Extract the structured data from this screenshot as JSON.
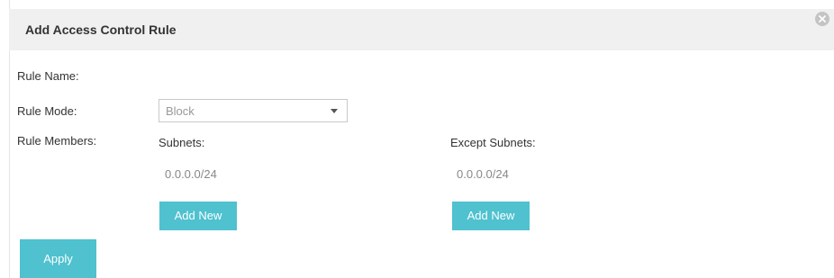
{
  "dialog": {
    "title": "Add Access Control Rule",
    "close_icon": "close-circle-icon"
  },
  "form": {
    "rule_name_label": "Rule Name:",
    "rule_mode_label": "Rule Mode:",
    "rule_mode_value": "Block",
    "rule_mode_arrow_icon": "chevron-down-icon",
    "rule_members_label": "Rule Members:",
    "subnets": {
      "label": "Subnets:",
      "value": "0.0.0.0/24",
      "add_label": "Add New"
    },
    "except_subnets": {
      "label": "Except Subnets:",
      "value": "0.0.0.0/24",
      "add_label": "Add New"
    }
  },
  "actions": {
    "apply_label": "Apply"
  },
  "colors": {
    "accent": "#4fc1cf",
    "header_bg": "#f0f0f0"
  }
}
